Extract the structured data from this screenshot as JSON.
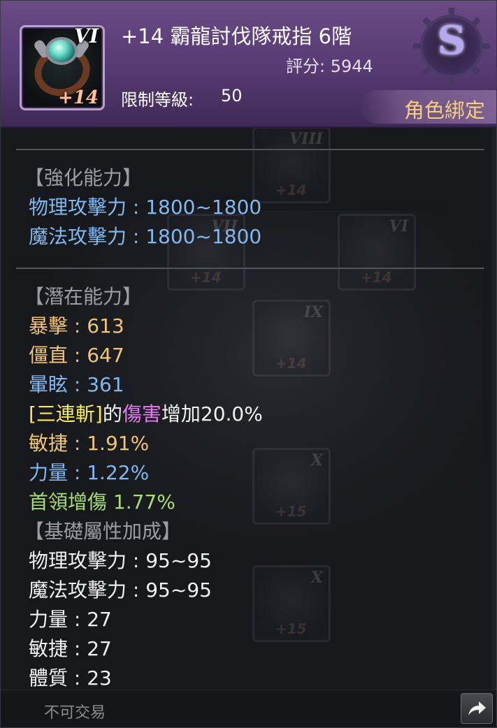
{
  "item": {
    "name": "+14 霸龍討伐隊戒指 6階",
    "score": "評分: 5944",
    "level_label": "限制等級:",
    "level_value": "50",
    "binding": "角色綁定",
    "grade": "S",
    "icon": {
      "tier": "VI",
      "plus": "+14",
      "icon_name": "ring-icon"
    }
  },
  "sections": {
    "enhance": {
      "title": "【強化能力】",
      "lines": [
        "物理攻擊力 : 1800~1800",
        "魔法攻擊力 : 1800~1800"
      ]
    },
    "potential": {
      "title": "【潛在能力】",
      "lines": {
        "crit": "暴擊 : 613",
        "stiff": "僵直 : 647",
        "stun": "暈眩 : 361",
        "skill_bracket": "[三連斬]",
        "skill_of": "的",
        "skill_damage": "傷害",
        "skill_rest": "增加20.0%",
        "agility": "敏捷 : 1.91%",
        "strength": "力量 : 1.22%",
        "boss": "首領增傷 1.77%"
      }
    },
    "base": {
      "title": "【基礎屬性加成】",
      "lines": [
        "物理攻擊力 : 95~95",
        "魔法攻擊力 : 95~95",
        "力量 : 27",
        "敏捷 : 27",
        "體質 : 23"
      ]
    }
  },
  "footer": {
    "trade": "不可交易",
    "share_icon": "share-arrow-icon"
  },
  "background_ghosts": [
    {
      "tier": "VIII",
      "plus": "+14"
    },
    {
      "tier": "VII",
      "plus": "+14"
    },
    {
      "tier": "VI",
      "plus": "+14"
    },
    {
      "tier": "IX",
      "plus": "+14"
    },
    {
      "tier": "X",
      "plus": "+15"
    },
    {
      "tier": "X",
      "plus": "+15"
    }
  ],
  "colors": {
    "header": "#6b4a86",
    "blue_text": "#7fb9ef",
    "gold_text": "#f0c672",
    "green_text": "#a8de6e",
    "binding_text": "#f5cf80",
    "grade_letter": "#b7a8f4"
  }
}
